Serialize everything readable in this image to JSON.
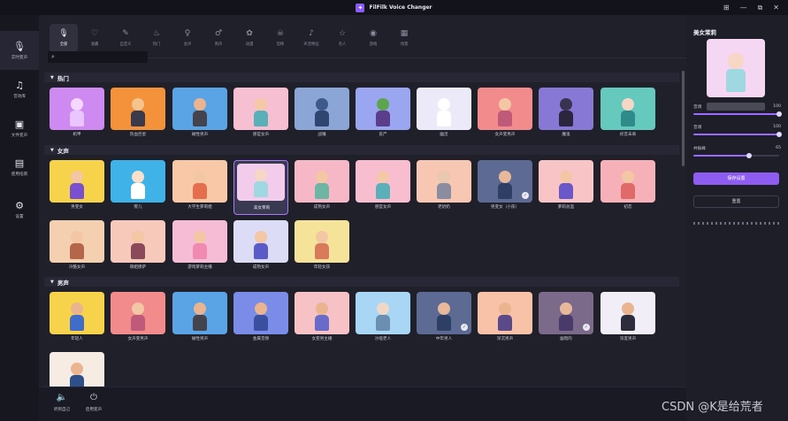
{
  "window": {
    "title": "FilFilk Voice Changer",
    "controls": [
      "⊞",
      "—",
      "⧉",
      "✕"
    ]
  },
  "sidebar": {
    "items": [
      {
        "label": "实时变声",
        "icon": "microphone-icon",
        "active": true
      },
      {
        "label": "音效库",
        "icon": "music-note-icon",
        "active": false
      },
      {
        "label": "文件变声",
        "icon": "folder-icon",
        "active": false
      },
      {
        "label": "使用指南",
        "icon": "guide-icon",
        "active": false
      },
      {
        "label": "设置",
        "icon": "gear-icon",
        "active": false
      }
    ]
  },
  "category_tabs": [
    {
      "label": "全部",
      "icon": "microphone-icon",
      "active": true
    },
    {
      "label": "收藏",
      "icon": "heart-icon",
      "active": false
    },
    {
      "label": "自定义",
      "icon": "custom-icon",
      "active": false
    },
    {
      "label": "热门",
      "icon": "fire-icon",
      "active": false
    },
    {
      "label": "女声",
      "icon": "female-icon",
      "active": false
    },
    {
      "label": "男声",
      "icon": "male-icon",
      "active": false
    },
    {
      "label": "动漫",
      "icon": "anime-icon",
      "active": false
    },
    {
      "label": "恐怖",
      "icon": "ghost-icon",
      "active": false
    },
    {
      "label": "声音特征",
      "icon": "note-icon",
      "active": false
    },
    {
      "label": "名人",
      "icon": "star-icon",
      "active": false
    },
    {
      "label": "游戏",
      "icon": "gamepad-icon",
      "active": false
    },
    {
      "label": "场景",
      "icon": "scene-icon",
      "active": false
    }
  ],
  "search": {
    "placeholder": ""
  },
  "sections": [
    {
      "title": "热门",
      "voices": [
        {
          "label": "机甲",
          "bg": "#cf8af2",
          "skin": "#f6d8ff",
          "body": "#e9c6ff"
        },
        {
          "label": "热血巨星",
          "bg": "#f3923b",
          "skin": "#f5c48e",
          "body": "#3a3a4a"
        },
        {
          "label": "磁性男声",
          "bg": "#5aa4e6",
          "skin": "#e9b48f",
          "body": "#44444f"
        },
        {
          "label": "感官女声",
          "bg": "#f6bfd2",
          "skin": "#f5c9a8",
          "body": "#5ab0b9"
        },
        {
          "label": "战锤",
          "bg": "#8aa5d6",
          "skin": "#3c5a8c",
          "body": "#2f4670"
        },
        {
          "label": "丧尸",
          "bg": "#9aa6f0",
          "skin": "#5ea44e",
          "body": "#5c3d8c"
        },
        {
          "label": "幽灵",
          "bg": "#ece9f8",
          "skin": "#ffffff",
          "body": "#ffffff"
        },
        {
          "label": "女声变男声",
          "bg": "#f28c8c",
          "skin": "#f3c6a4",
          "body": "#c05a7a"
        },
        {
          "label": "魔鬼",
          "bg": "#8778d6",
          "skin": "#3a3350",
          "body": "#2b2540"
        },
        {
          "label": "初音未来",
          "bg": "#66c9bd",
          "skin": "#f6d6c4",
          "body": "#2f8a8a"
        }
      ]
    },
    {
      "title": "女声",
      "voices": [
        {
          "label": "男变女",
          "bg": "#f7d34c",
          "skin": "#f3c6a4",
          "body": "#7a4fd0",
          "badge": false
        },
        {
          "label": "婴儿",
          "bg": "#3fb3e8",
          "skin": "#f8e0cc",
          "body": "#ffffff",
          "badge": false
        },
        {
          "label": "大学生萝莉姐",
          "bg": "#f9c8a6",
          "skin": "#f3c6a4",
          "body": "#e46e4e",
          "badge": false
        },
        {
          "label": "美女茉莉",
          "bg": "#f3ccec",
          "skin": "#f6d6c4",
          "body": "#9fd8e0",
          "badge": false,
          "selected": true
        },
        {
          "label": "成熟女声",
          "bg": "#f6b7c7",
          "skin": "#f3c6a4",
          "body": "#6fb5a4",
          "badge": false
        },
        {
          "label": "感官女声",
          "bg": "#f9bdd0",
          "skin": "#f5c9a8",
          "body": "#5ab0b9",
          "badge": false
        },
        {
          "label": "老奶奶",
          "bg": "#f7c7b4",
          "skin": "#e9c8b0",
          "body": "#8c8ca0",
          "badge": false
        },
        {
          "label": "男变女（小孩）",
          "bg": "#5c6a94",
          "skin": "#e7b99a",
          "body": "#2e3f66",
          "badge": true
        },
        {
          "label": "萝莉总监",
          "bg": "#f9c4c6",
          "skin": "#f3c6a4",
          "body": "#6a58c8",
          "badge": false
        },
        {
          "label": "初恋",
          "bg": "#f6b0b8",
          "skin": "#f3c6a4",
          "body": "#e06a6a",
          "badge": false
        },
        {
          "label": "冷酷女声",
          "bg": "#f4cfb0",
          "skin": "#f3c6a4",
          "body": "#b5664a",
          "badge": false
        },
        {
          "label": "御姐撩萨",
          "bg": "#f6c9ba",
          "skin": "#f3c6a4",
          "body": "#8a4a5a",
          "badge": false
        },
        {
          "label": "游戏萝莉主播",
          "bg": "#f6bcd6",
          "skin": "#f3c6a4",
          "body": "#f08ab0",
          "badge": false
        },
        {
          "label": "成熟女声",
          "bg": "#dcdcf6",
          "skin": "#f3c6a4",
          "body": "#5a5ac8",
          "badge": false
        },
        {
          "label": "年轻女孩",
          "bg": "#f6e39a",
          "skin": "#f3c6a4",
          "body": "#d97b5a",
          "badge": false
        }
      ]
    },
    {
      "title": "男声",
      "voices": [
        {
          "label": "年轻人",
          "bg": "#f7d34c",
          "skin": "#e9b48f",
          "body": "#3f6dc8",
          "badge": false
        },
        {
          "label": "女声变男声",
          "bg": "#f28c8c",
          "skin": "#f3c6a4",
          "body": "#c05a7a",
          "badge": false
        },
        {
          "label": "磁性男声",
          "bg": "#5aa4e6",
          "skin": "#e9b48f",
          "body": "#44444f",
          "badge": false
        },
        {
          "label": "金属音频",
          "bg": "#7a8ce8",
          "skin": "#e9b48f",
          "body": "#3a4fa0",
          "badge": false
        },
        {
          "label": "女变男主播",
          "bg": "#f6c2c6",
          "skin": "#e9b48f",
          "body": "#6a6ac8",
          "badge": false
        },
        {
          "label": "沙哑老人",
          "bg": "#a8d6f4",
          "skin": "#f0d8c8",
          "body": "#6a8fb0",
          "badge": false
        },
        {
          "label": "中年男人",
          "bg": "#5c6a94",
          "skin": "#e7b99a",
          "body": "#2e3f66",
          "badge": true
        },
        {
          "label": "深沉男声",
          "bg": "#f7c2a8",
          "skin": "#e9b48f",
          "body": "#5a4a8a",
          "badge": false
        },
        {
          "label": "幽暗的",
          "bg": "#7b6a8a",
          "skin": "#e7b99a",
          "body": "#4a3a6a",
          "badge": true
        },
        {
          "label": "深度男声",
          "bg": "#f1eef8",
          "skin": "#e9b48f",
          "body": "#2c2c3c",
          "badge": false
        },
        {
          "label": "",
          "bg": "#f6ece4",
          "skin": "#e9b48f",
          "body": "#2f4f8a",
          "badge": false
        }
      ]
    }
  ],
  "bottom": {
    "items": [
      {
        "label": "听到自己",
        "icon": "ear-icon"
      },
      {
        "label": "启用变声",
        "icon": "toggle-icon"
      }
    ]
  },
  "right_panel": {
    "voice_name": "美女茉莉",
    "preview_button": "",
    "sliders": [
      {
        "label": "音调",
        "value": "100",
        "fraction": 1.0
      },
      {
        "label": "音调",
        "value": "100",
        "fraction": 1.0
      },
      {
        "label": "共振峰",
        "value": "65",
        "fraction": 0.65
      }
    ],
    "save_label": "保存设置",
    "reset_label": "重置"
  },
  "watermark": "CSDN @K是给荒者"
}
